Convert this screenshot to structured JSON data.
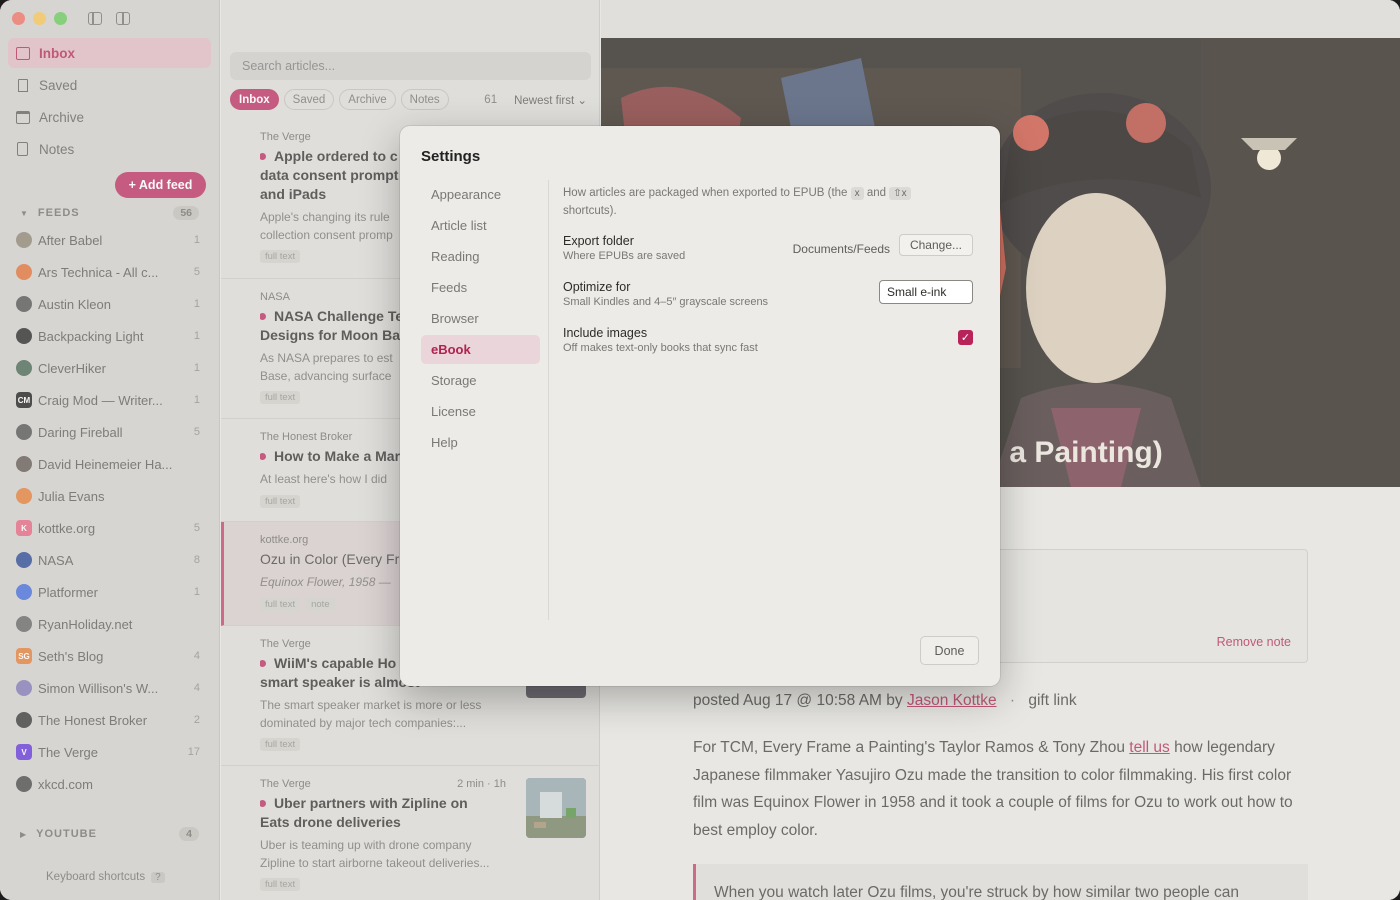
{
  "sidebar": {
    "nav": [
      {
        "label": "Inbox",
        "active": true
      },
      {
        "label": "Saved"
      },
      {
        "label": "Archive"
      },
      {
        "label": "Notes"
      }
    ],
    "add_feed_label": "+ Add feed",
    "feeds_header": "FEEDS",
    "feeds_count": "56",
    "feeds": [
      {
        "name": "After Babel",
        "count": "1",
        "color": "#8a7d6e"
      },
      {
        "name": "Ars Technica - All c...",
        "count": "5",
        "color": "#e06a2c"
      },
      {
        "name": "Austin Kleon",
        "count": "1",
        "color": "#4a4a4a"
      },
      {
        "name": "Backpacking Light",
        "count": "1",
        "color": "#1d1d1d"
      },
      {
        "name": "CleverHiker",
        "count": "1",
        "color": "#3f5d48"
      },
      {
        "name": "Craig Mod — Writer...",
        "count": "1",
        "color": "#111111",
        "mono": "CM"
      },
      {
        "name": "Daring Fireball",
        "count": "5",
        "color": "#4a4a4a"
      },
      {
        "name": "David Heinemeier Ha...",
        "count": "",
        "color": "#5b5048"
      },
      {
        "name": "Julia Evans",
        "count": "",
        "color": "#e2762d"
      },
      {
        "name": "kottke.org",
        "count": "5",
        "color": "#e45c7a",
        "mono": "K"
      },
      {
        "name": "NASA",
        "count": "8",
        "color": "#1f3f8f"
      },
      {
        "name": "Platformer",
        "count": "1",
        "color": "#3a63d9"
      },
      {
        "name": "RyanHoliday.net",
        "count": "",
        "color": "#5d5d5d"
      },
      {
        "name": "Seth's Blog",
        "count": "4",
        "color": "#e2762d",
        "mono": "SG"
      },
      {
        "name": "Simon Willison's W...",
        "count": "4",
        "color": "#7a6fb0"
      },
      {
        "name": "The Honest Broker",
        "count": "2",
        "color": "#2d2d2d"
      },
      {
        "name": "The Verge",
        "count": "17",
        "color": "#5b2bd9",
        "mono": "V"
      },
      {
        "name": "xkcd.com",
        "count": "",
        "color": "#3f3f3f"
      }
    ],
    "youtube_header": "YOUTUBE",
    "youtube_count": "4",
    "keyboard_shortcuts": "Keyboard shortcuts",
    "keyboard_q": "?"
  },
  "list": {
    "search_placeholder": "Search articles...",
    "filters": [
      "Inbox",
      "Saved",
      "Archive",
      "Notes"
    ],
    "count": "61",
    "sort": "Newest first ⌄",
    "articles": [
      {
        "source": "The Verge",
        "title": "Apple ordered to c",
        "title2": "data consent prompt",
        "title3": "and iPads",
        "excerpt": "Apple's changing its rule",
        "excerpt2": "collection consent promp",
        "tags": [
          "full text"
        ]
      },
      {
        "source": "NASA",
        "title": "NASA Challenge Te",
        "title2": "Designs for Moon Ba",
        "excerpt": "As NASA prepares to est",
        "excerpt2": "Base, advancing surface",
        "tags": [
          "full text"
        ]
      },
      {
        "source": "The Honest Broker",
        "title": "How to Make a Mar",
        "excerpt": "At least here's how I did",
        "tags": [
          "full text"
        ]
      },
      {
        "source": "kottke.org",
        "title": "Ozu in Color (Every Fr",
        "excerpt": "Equinox Flower, 1958 — ",
        "tags": [
          "full text",
          "note"
        ]
      },
      {
        "source": "The Verge",
        "title": "WiiM's capable Ho",
        "title2": "smart speaker is almost",
        "excerpt": "The smart speaker market is more or less",
        "excerpt2": "dominated by major tech companies:...",
        "tags": [
          "full text"
        ]
      },
      {
        "source": "The Verge",
        "meta": "2 min · 1h",
        "title": "Uber partners with Zipline on",
        "title2": "Eats drone deliveries",
        "excerpt": "Uber is teaming up with drone company",
        "excerpt2": "Zipline to start airborne takeout deliveries...",
        "tags": [
          "full text"
        ]
      }
    ]
  },
  "reader": {
    "hero_title": "ame a Painting)",
    "remove_note": "Remove note",
    "posted_prefix": "posted Aug 17 @ 10:58 AM by",
    "author": "Jason Kottke",
    "sep": "·",
    "gift_link": "gift link",
    "body_1": "For TCM, Every Frame a Painting's Taylor Ramos & Tony Zhou",
    "body_link": "tell us",
    "body_2": "how legendary Japanese filmmaker Yasujiro Ozu made the transition to color filmmaking. His first color film was Equinox Flower in 1958 and it took a couple of films for Ozu to work out how to best employ color.",
    "quote": "When you watch later Ozu films, you're struck by how similar two people can"
  },
  "settings": {
    "title": "Settings",
    "nav": [
      "Appearance",
      "Article list",
      "Reading",
      "Feeds",
      "Browser",
      "eBook",
      "Storage",
      "License",
      "Help"
    ],
    "active": "eBook",
    "desc_1": "How articles are packaged when exported to EPUB (the",
    "kbd_1": "x",
    "desc_and": "and",
    "kbd_2": "⇧x",
    "desc_2": "shortcuts).",
    "export_folder_label": "Export folder",
    "export_folder_sub": "Where EPUBs are saved",
    "export_folder_path": "Documents/Feeds",
    "change_label": "Change...",
    "optimize_label": "Optimize for",
    "optimize_sub": "Small Kindles and 4–5″ grayscale screens",
    "optimize_value": "Small e-ink",
    "images_label": "Include images",
    "images_sub": "Off makes text-only books that sync fast",
    "images_checked": true,
    "done_label": "Done"
  },
  "colors": {
    "accent": "#b8245a",
    "sidebar_bg": "#cfcdc9",
    "list_bg": "#dcdad6"
  }
}
